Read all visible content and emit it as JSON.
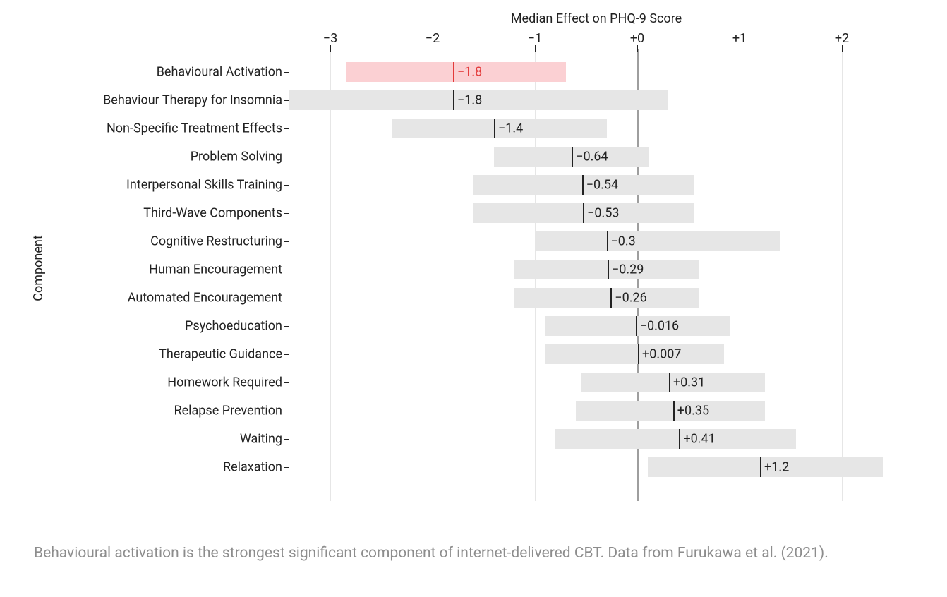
{
  "chart_data": {
    "type": "bar",
    "title": "Median Effect on PHQ-9 Score",
    "ylabel": "Component",
    "xlabel": "",
    "xlim": [
      -3.4,
      2.6
    ],
    "x_ticks": [
      -3,
      -2,
      -1,
      0,
      1,
      2
    ],
    "x_tick_labels": [
      "−3",
      "−2",
      "−1",
      "+0",
      "+1",
      "+2"
    ],
    "series": [
      {
        "name": "Behavioural Activation",
        "median": -1.8,
        "low": -2.85,
        "high": -0.7,
        "label": "−1.8",
        "highlight": true
      },
      {
        "name": "Behaviour Therapy for Insomnia",
        "median": -1.8,
        "low": -3.4,
        "high": 0.3,
        "label": "−1.8",
        "highlight": false
      },
      {
        "name": "Non-Specific Treatment Effects",
        "median": -1.4,
        "low": -2.4,
        "high": -0.3,
        "label": "−1.4",
        "highlight": false
      },
      {
        "name": "Problem Solving",
        "median": -0.64,
        "low": -1.4,
        "high": 0.12,
        "label": "−0.64",
        "highlight": false
      },
      {
        "name": "Interpersonal Skills Training",
        "median": -0.54,
        "low": -1.6,
        "high": 0.55,
        "label": "−0.54",
        "highlight": false
      },
      {
        "name": "Third-Wave Components",
        "median": -0.53,
        "low": -1.6,
        "high": 0.55,
        "label": "−0.53",
        "highlight": false
      },
      {
        "name": "Cognitive Restructuring",
        "median": -0.3,
        "low": -1.0,
        "high": 1.4,
        "label": "−0.3",
        "highlight": false
      },
      {
        "name": "Human Encouragement",
        "median": -0.29,
        "low": -1.2,
        "high": 0.6,
        "label": "−0.29",
        "highlight": false
      },
      {
        "name": "Automated Encouragement",
        "median": -0.26,
        "low": -1.2,
        "high": 0.6,
        "label": "−0.26",
        "highlight": false
      },
      {
        "name": "Psychoeducation",
        "median": -0.016,
        "low": -0.9,
        "high": 0.9,
        "label": "−0.016",
        "highlight": false
      },
      {
        "name": "Therapeutic Guidance",
        "median": 0.007,
        "low": -0.9,
        "high": 0.85,
        "label": "+0.007",
        "highlight": false
      },
      {
        "name": "Homework Required",
        "median": 0.31,
        "low": -0.55,
        "high": 1.25,
        "label": "+0.31",
        "highlight": false
      },
      {
        "name": "Relapse Prevention",
        "median": 0.35,
        "low": -0.6,
        "high": 1.25,
        "label": "+0.35",
        "highlight": false
      },
      {
        "name": "Waiting",
        "median": 0.41,
        "low": -0.8,
        "high": 1.55,
        "label": "+0.41",
        "highlight": false
      },
      {
        "name": "Relaxation",
        "median": 1.2,
        "low": 0.1,
        "high": 2.4,
        "label": "+1.2",
        "highlight": false
      }
    ]
  },
  "caption": "Behavioural activation is the strongest significant component of internet-delivered CBT. Data from Furukawa et al. (2021)."
}
